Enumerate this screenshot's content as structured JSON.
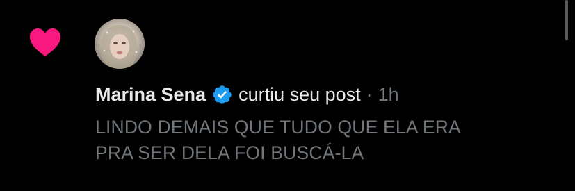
{
  "notification": {
    "type_icon": "heart-icon",
    "user_name": "Marina Sena",
    "verified": true,
    "verified_icon": "verified-badge-icon",
    "action": "curtiu seu post",
    "separator": "·",
    "time_ago": "1h",
    "post_lines": [
      "LINDO DEMAIS QUE TUDO QUE ELA ERA",
      "PRA SER DELA FOI BUSCÁ-LA"
    ]
  },
  "colors": {
    "background": "#000000",
    "heart": "#f91880",
    "verified": "#1d9bf0",
    "primary_text": "#e7e9ea",
    "secondary_text": "#71767b"
  }
}
